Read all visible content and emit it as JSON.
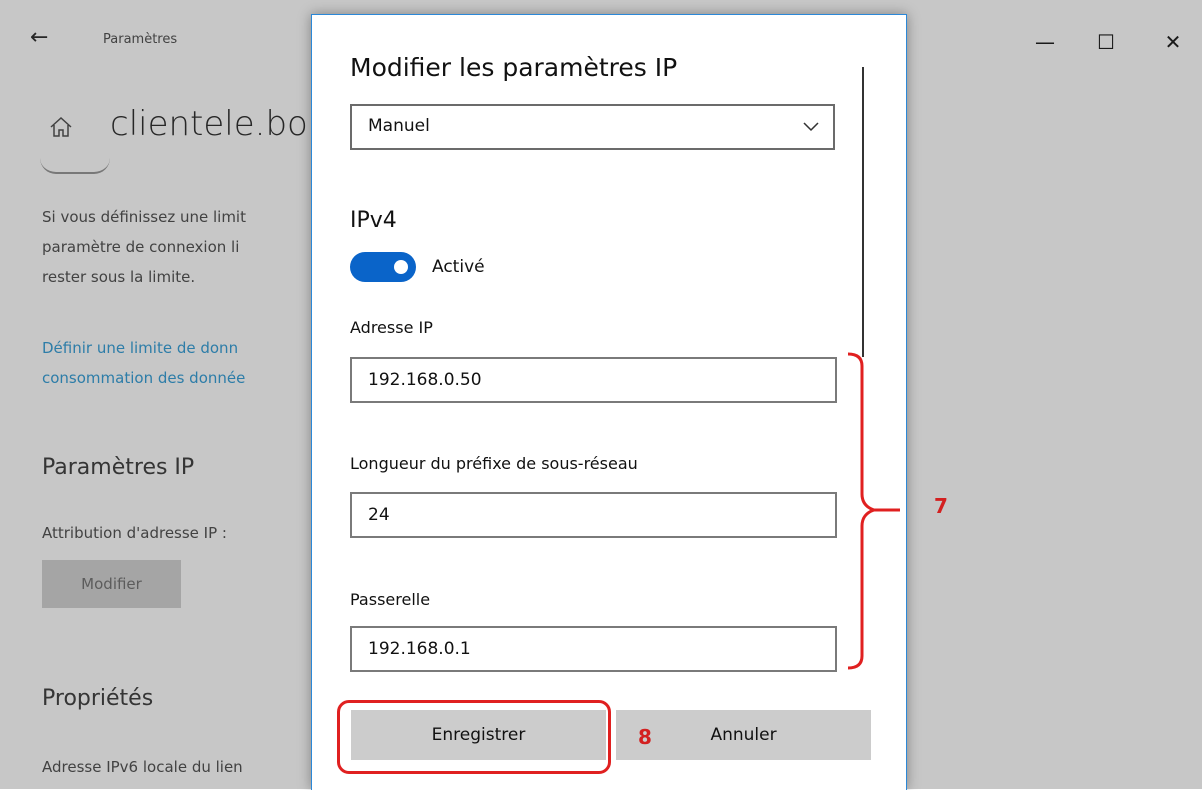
{
  "window": {
    "title": "Paramètres",
    "controls": {
      "minimize": "—",
      "maximize": "☐",
      "close": "✕"
    }
  },
  "background": {
    "heading": "clientele.bo",
    "description_lines": [
      "Si vous définissez une limit",
      "paramètre de connexion li",
      "rester sous la limite."
    ],
    "link_lines": [
      "Définir une limite de donn",
      "consommation des donnée"
    ],
    "section_ip": "Paramètres IP",
    "attribution_label": "Attribution d'adresse IP :",
    "modify_button": "Modifier",
    "section_properties": "Propriétés",
    "ipv6_label": "Adresse IPv6 locale du lien"
  },
  "dialog": {
    "title": "Modifier les paramètres IP",
    "mode_select": "Manuel",
    "ipv4_heading": "IPv4",
    "toggle_label": "Activé",
    "toggle_on": true,
    "fields": {
      "ip_label": "Adresse IP",
      "ip_value": "192.168.0.50",
      "prefix_label": "Longueur du préfixe de sous-réseau",
      "prefix_value": "24",
      "gateway_label": "Passerelle",
      "gateway_value": "192.168.0.1"
    },
    "save_button": "Enregistrer",
    "cancel_button": "Annuler"
  },
  "annotations": {
    "bracket_number": "7",
    "save_number": "8",
    "color": "#e02020"
  },
  "colors": {
    "accent": "#0a64c9",
    "link": "#3aa0d8",
    "dialog_border": "#2b88d8"
  }
}
